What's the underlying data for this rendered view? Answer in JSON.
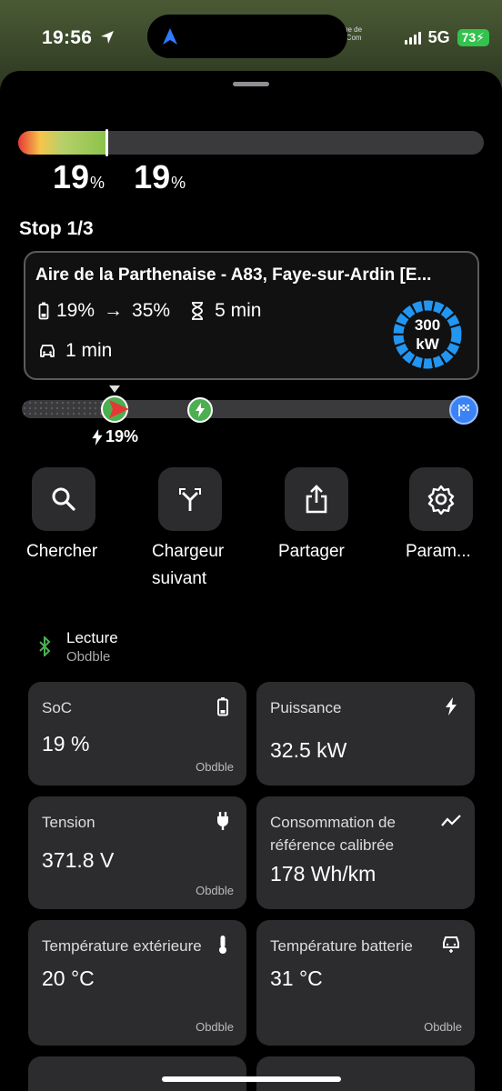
{
  "status_bar": {
    "time": "19:56",
    "network": "5G",
    "battery": "73",
    "map_place": "ne de\n-Com"
  },
  "soc_bar": {
    "fill_fraction": 0.19,
    "current_soc": "19",
    "target_soc": "19",
    "unit": "%"
  },
  "stop": {
    "title": "Stop 1/3",
    "name": "Aire de la Parthenaise - A83, Faye-sur-Ardin [E...",
    "soc_from": "19%",
    "arrow": "→",
    "soc_to": "35%",
    "charge_time": "5 min",
    "drive_time": "1 min",
    "power_value": "300",
    "power_unit": "kW"
  },
  "route": {
    "car_soc": "19%",
    "progress_fraction": 0.19
  },
  "actions": [
    {
      "label": "Chercher",
      "icon": "search-icon"
    },
    {
      "label": "Chargeur suivant",
      "icon": "fork-arrows-icon"
    },
    {
      "label": "Partager",
      "icon": "share-icon"
    },
    {
      "label": "Param...",
      "icon": "gear-icon"
    }
  ],
  "bluetooth": {
    "title": "Lecture",
    "subtitle": "Obdble"
  },
  "tiles": [
    {
      "label": "SoC",
      "value": "19 %",
      "source": "Obdble",
      "icon": "battery-icon"
    },
    {
      "label": "Puissance",
      "value": "32.5 kW",
      "source": "",
      "icon": "bolt-icon"
    },
    {
      "label": "Tension",
      "value": "371.8 V",
      "source": "Obdble",
      "icon": "plug-icon"
    },
    {
      "label": "Consommation de référence calibrée",
      "value": "178 Wh/km",
      "source": "",
      "icon": "trend-icon"
    },
    {
      "label": "Température extérieure",
      "value": "20 °C",
      "source": "Obdble",
      "icon": "thermometer-icon"
    },
    {
      "label": "Température batterie",
      "value": "31 °C",
      "source": "Obdble",
      "icon": "car-battery-icon"
    }
  ],
  "colors": {
    "accent_green": "#4caf50",
    "accent_blue": "#3b82f6",
    "sheet_bg": "#000000",
    "tile_bg": "#2c2c2e"
  }
}
